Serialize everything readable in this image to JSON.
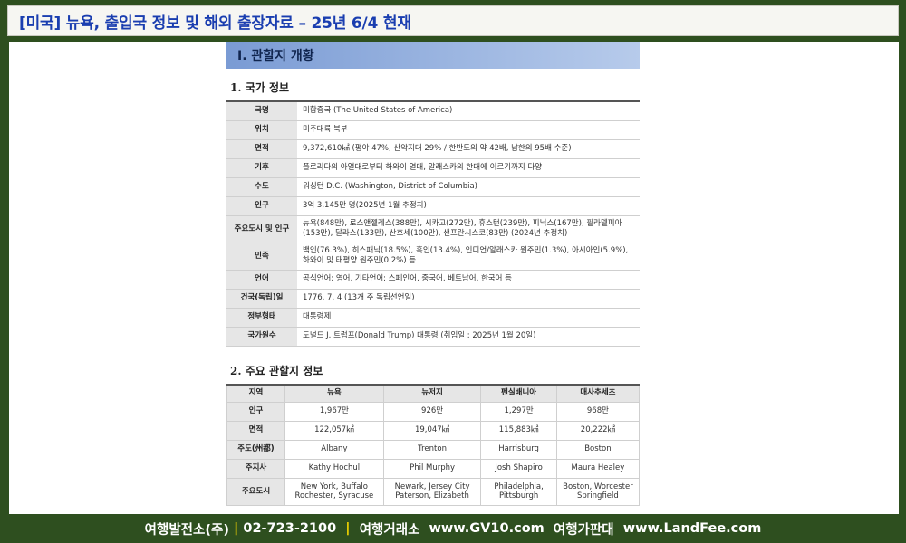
{
  "header": {
    "title": "[미국] 뉴욕,  출입국 정보 및 해외 출장자료 – 25년 6/4 현재"
  },
  "doc": {
    "banner": "Ⅰ. 관할지 개황",
    "section1": "1. 국가 정보",
    "country_info": [
      {
        "key": "국명",
        "value": "미합중국 (The United States of America)"
      },
      {
        "key": "위치",
        "value": "미주대륙 북부"
      },
      {
        "key": "면적",
        "value": "9,372,610㎢ (평야 47%, 산악지대 29% / 한반도의 약 42배, 남한의 95배 수준)"
      },
      {
        "key": "기후",
        "value": "플로리다의 아열대로부터 하와이 열대, 알래스카의 한대에 이르기까지 다양"
      },
      {
        "key": "수도",
        "value": "워싱턴 D.C. (Washington, District of Columbia)"
      },
      {
        "key": "인구",
        "value": "3억 3,145만 명(2025년 1월 추정치)"
      },
      {
        "key": "주요도시 및 인구",
        "value": "뉴욕(848만), 로스앤젤레스(388만), 시카고(272만), 휴스턴(239만), 피닉스(167만), 필라델피아(153만), 달라스(133만), 산호세(100만), 샌프란시스코(83만) (2024년 추정치)"
      },
      {
        "key": "민족",
        "value": "백인(76.3%), 히스패닉(18.5%), 흑인(13.4%), 인디언/알래스카 원주민(1.3%), 아시아인(5.9%), 하와이 및 태평양 원주민(0.2%)   등"
      },
      {
        "key": "언어",
        "value": "공식언어: 영어, 기타언어: 스페인어, 중국어, 베트남어, 한국어 등"
      },
      {
        "key": "건국(독립)일",
        "value": "1776. 7. 4 (13개 주 독립선언일)"
      },
      {
        "key": "정부형태",
        "value": "대통령제"
      },
      {
        "key": "국가원수",
        "value": "도널드 J. 트럼프(Donald Trump) 대통령 (취임일 : 2025년 1월 20일)"
      }
    ],
    "section2": "2. 주요 관할지 정보",
    "states_table": {
      "header_label": "지역",
      "columns": [
        "뉴욕",
        "뉴저지",
        "펜실배니아",
        "매사추세츠"
      ],
      "rows": [
        {
          "label": "인구",
          "cells": [
            "1,967만",
            "926만",
            "1,297만",
            "968만"
          ]
        },
        {
          "label": "면적",
          "cells": [
            "122,057㎢",
            "19,047㎢",
            "115,883㎢",
            "20,222㎢"
          ]
        },
        {
          "label": "주도(州都)",
          "cells": [
            "Albany",
            "Trenton",
            "Harrisburg",
            "Boston"
          ]
        },
        {
          "label": "주지사",
          "cells": [
            "Kathy Hochul",
            "Phil Murphy",
            "Josh Shapiro",
            "Maura Healey"
          ]
        },
        {
          "label": "주요도시",
          "cells": [
            "New York, Buffalo Rochester, Syracuse",
            "Newark, Jersey City Paterson, Elizabeth",
            "Philadelphia, Pittsburgh",
            "Boston, Worcester Springfield"
          ]
        }
      ]
    }
  },
  "footer": {
    "company": "여행발전소(주)",
    "phone": "02-723-2100",
    "label1": "여행거래소",
    "site1": "www.GV10.com",
    "label2": "여행가판대",
    "site2": "www.LandFee.com"
  }
}
